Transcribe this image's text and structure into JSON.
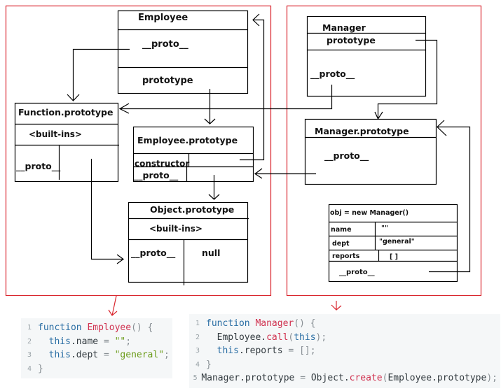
{
  "boxes": {
    "employee": {
      "title": "Employee",
      "proto": "__proto__",
      "prototype": "prototype"
    },
    "function_prototype": {
      "title": "Function.prototype",
      "builtins": "<built-ins>",
      "proto": "__proto__"
    },
    "employee_prototype": {
      "title": "Employee.prototype",
      "constructor": "constructor",
      "proto": "__proto__"
    },
    "object_prototype": {
      "title": "Object.prototype",
      "builtins": "<built-ins>",
      "proto": "__proto__",
      "proto_value": "null"
    },
    "manager": {
      "title": "Manager",
      "prototype": "prototype",
      "proto": "__proto__"
    },
    "manager_prototype": {
      "title": "Manager.prototype",
      "proto": "__proto__"
    },
    "obj_instance": {
      "title": "obj = new Manager()",
      "rows": [
        {
          "key": "name",
          "value": "\"\""
        },
        {
          "key": "dept",
          "value": "\"general\""
        },
        {
          "key": "reports",
          "value": "[ ]"
        }
      ],
      "proto": "__proto__"
    }
  },
  "colors": {
    "group_border": "#d9262e",
    "line": "#000000",
    "code_bg": "#f5f7f8"
  },
  "code": {
    "employee": [
      {
        "n": "1",
        "tokens": [
          [
            "kw",
            "function "
          ],
          [
            "fn",
            "Employee"
          ],
          [
            "pun",
            "() {"
          ]
        ]
      },
      {
        "n": "2",
        "tokens": [
          [
            "kw",
            "  this"
          ],
          [
            "id",
            ".name "
          ],
          [
            "pun",
            "= "
          ],
          [
            "str",
            "\"\""
          ],
          [
            "pun",
            ";"
          ]
        ]
      },
      {
        "n": "3",
        "tokens": [
          [
            "kw",
            "  this"
          ],
          [
            "id",
            ".dept "
          ],
          [
            "pun",
            "= "
          ],
          [
            "str",
            "\"general\""
          ],
          [
            "pun",
            ";"
          ]
        ]
      },
      {
        "n": "4",
        "tokens": [
          [
            "pun",
            "}"
          ]
        ]
      }
    ],
    "manager": [
      {
        "n": "1",
        "tokens": [
          [
            "kw",
            "function "
          ],
          [
            "fn",
            "Manager"
          ],
          [
            "pun",
            "() {"
          ]
        ]
      },
      {
        "n": "2",
        "tokens": [
          [
            "id",
            "  Employee."
          ],
          [
            "fn",
            "call"
          ],
          [
            "pun",
            "("
          ],
          [
            "kw",
            "this"
          ],
          [
            "pun",
            ");"
          ]
        ]
      },
      {
        "n": "3",
        "tokens": [
          [
            "kw",
            "  this"
          ],
          [
            "id",
            ".reports "
          ],
          [
            "pun",
            "= [];"
          ]
        ]
      },
      {
        "n": "4",
        "tokens": [
          [
            "pun",
            "}"
          ]
        ]
      },
      {
        "n": "5",
        "tokens": [
          [
            "id",
            "Manager.prototype "
          ],
          [
            "pun",
            "= "
          ],
          [
            "id",
            "Object."
          ],
          [
            "fn",
            "create"
          ],
          [
            "pun",
            "("
          ],
          [
            "id",
            "Employee.prototype"
          ],
          [
            "pun",
            ");"
          ]
        ]
      }
    ]
  }
}
